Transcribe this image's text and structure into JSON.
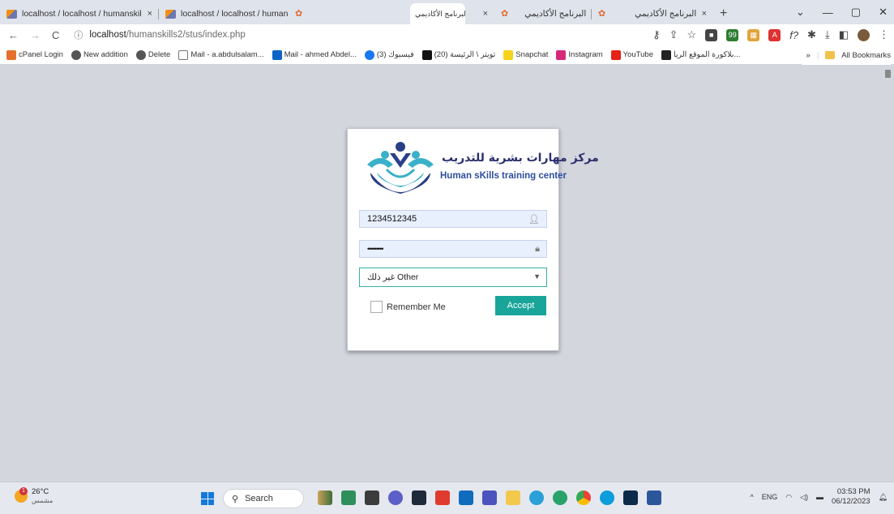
{
  "tabs": [
    {
      "title": "localhost / localhost / humanskil",
      "close": "×"
    },
    {
      "title": "localhost / localhost / humanskil",
      "close": "×"
    },
    {
      "title": "البرنامج الأكاديمي",
      "close": "×"
    },
    {
      "title": "البرنامج الأكاديمي",
      "close": "×"
    },
    {
      "title": "البرنامج الأكاديمي",
      "close": "×"
    }
  ],
  "new_tab": "+",
  "window_controls": {
    "dropdown": "⌄",
    "minimize": "—",
    "maximize": "▢",
    "close": "✕"
  },
  "address": {
    "host": "localhost",
    "path": "/humanskills2/stus/index.php"
  },
  "bookmarks": [
    {
      "label": "cPanel Login",
      "color": "#e4702b"
    },
    {
      "label": "New addition",
      "color": "#555555"
    },
    {
      "label": "Delete",
      "color": "#555555"
    },
    {
      "label": "Mail - a.abdulsalam...",
      "color": "#777777"
    },
    {
      "label": "Mail - ahmed Abdel...",
      "color": "#0a64c8"
    },
    {
      "label": "(3) فيسبوك",
      "color": "#1877f2"
    },
    {
      "label": "(20) تويتر \\ الرئيسة",
      "color": "#111111"
    },
    {
      "label": "Snapchat",
      "color": "#f7d21a"
    },
    {
      "label": "Instagram",
      "color": "#d6297a"
    },
    {
      "label": "YouTube",
      "color": "#e62117"
    },
    {
      "label": "بلاكورة الموقع الريا...",
      "color": "#222222"
    }
  ],
  "bookmarks_more": "»",
  "all_bookmarks": "All Bookmarks",
  "logo": {
    "arabic": "مركز مهارات بشرية للتدريب",
    "english": "Human sKills training center"
  },
  "form": {
    "username_value": "1234512345",
    "password_value": "•••••••••",
    "select_value": "غير ذلك Other",
    "remember_label": "Remember Me",
    "accept_label": "Accept"
  },
  "taskbar": {
    "temperature": "26°C",
    "weather_text": "مشمس",
    "weather_badge": "1",
    "search_label": "Search",
    "lang": "ENG",
    "time": "03:53 PM",
    "date": "06/12/2023",
    "tray_up": "^"
  },
  "colors": {
    "accent": "#1aa59a",
    "field_bg": "#e8f0fe",
    "content_bg": "#d4d6de"
  }
}
